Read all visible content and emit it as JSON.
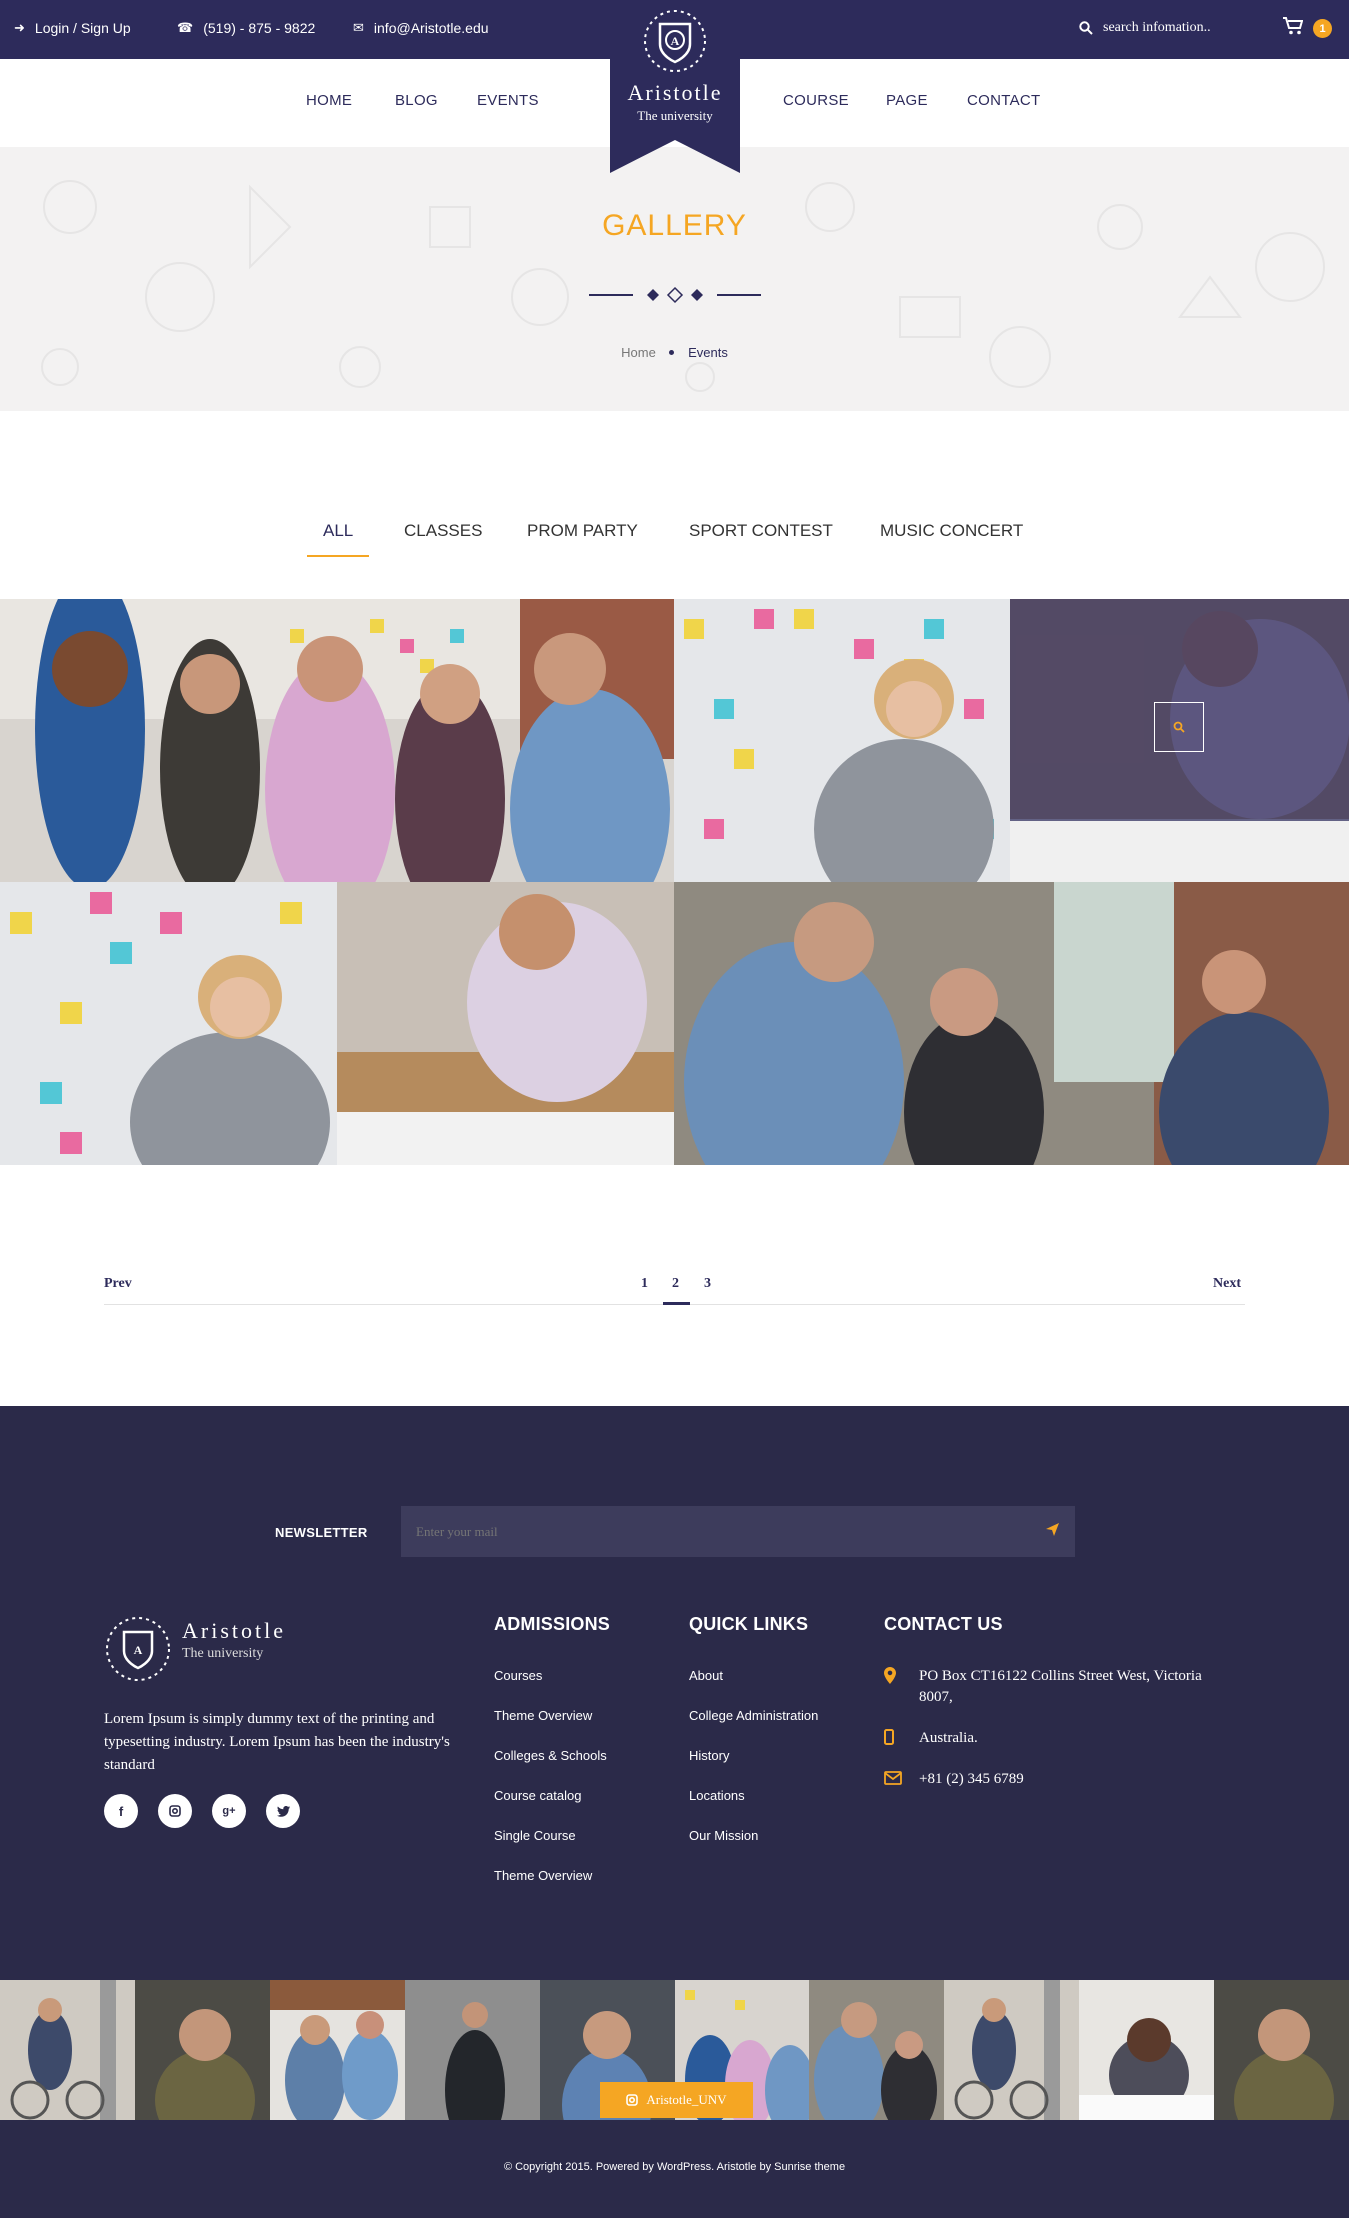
{
  "topbar": {
    "login": "Login / Sign Up",
    "phone": "(519) - 875 - 9822",
    "email": "info@Aristotle.edu",
    "search_placeholder": "search infomation..",
    "cart_count": "1"
  },
  "logo": {
    "name": "Aristotle",
    "subtitle": "The university"
  },
  "nav": {
    "items": [
      "HOME",
      "BLOG",
      "EVENTS",
      "COURSE",
      "PAGE",
      "CONTACT"
    ]
  },
  "hero": {
    "title": "GALLERY",
    "breadcrumb": [
      "Home",
      "Events"
    ]
  },
  "filters": {
    "tabs": [
      "ALL",
      "CLASSES",
      "PROM PARTY",
      "SPORT CONTEST",
      "MUSIC CONCERT"
    ],
    "active": "ALL"
  },
  "pagination": {
    "prev": "Prev",
    "pages": [
      "1",
      "2",
      "3"
    ],
    "current": "2",
    "next": "Next"
  },
  "footer": {
    "newsletter_label": "NEWSLETTER",
    "newsletter_placeholder": "Enter your mail",
    "logo_name": "Aristotle",
    "logo_subtitle": "The university",
    "about": "Lorem Ipsum is simply dummy text of the printing and typesetting industry. Lorem Ipsum has been the industry's standard",
    "admissions": {
      "title": "ADMISSIONS",
      "links": [
        "Courses",
        "Theme Overview",
        "Colleges & Schools",
        "Course catalog",
        "Single Course",
        "Theme Overview"
      ]
    },
    "quick_links": {
      "title": "QUICK LINKS",
      "links": [
        "About",
        "College Administration",
        "History",
        "Locations",
        "Our Mission"
      ]
    },
    "contact": {
      "title": "CONTACT US",
      "address": "PO Box CT16122 Collins Street West, Victoria 8007,",
      "country": "Australia.",
      "phone": "+81 (2) 345 6789"
    },
    "instagram_label": "Aristotle_UNV",
    "copyright": "© Copyright 2015. Powered by WordPress. Aristotle by Sunrise theme"
  },
  "colors": {
    "brand": "#2d2b5b",
    "accent": "#f5a623",
    "footer_bg": "#2b2a49"
  }
}
